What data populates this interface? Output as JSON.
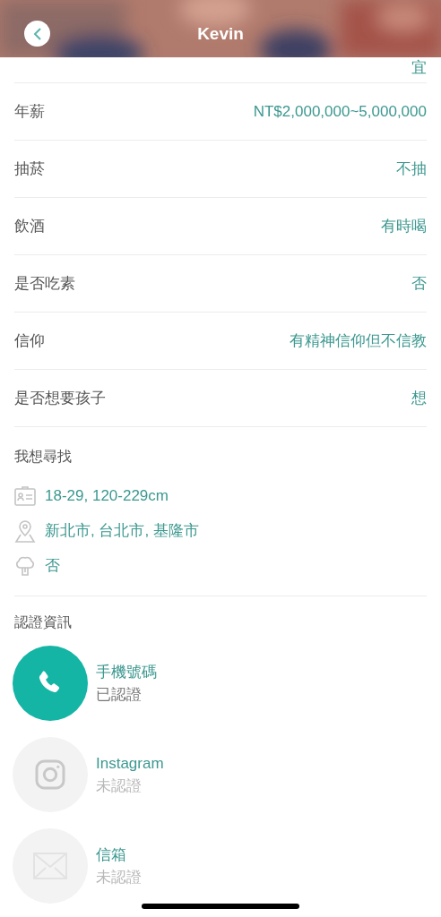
{
  "header": {
    "title": "Kevin"
  },
  "rows": [
    {
      "value": "宜"
    },
    {
      "label": "年薪",
      "value": "NT$2,000,000~5,000,000"
    },
    {
      "label": "抽菸",
      "value": "不抽"
    },
    {
      "label": "飲酒",
      "value": "有時喝"
    },
    {
      "label": "是否吃素",
      "value": "否"
    },
    {
      "label": "信仰",
      "value": "有精神信仰但不信教"
    },
    {
      "label": "是否想要孩子",
      "value": "想"
    }
  ],
  "looking_for": {
    "title": "我想尋找",
    "items": [
      {
        "kind": "profile",
        "text": "18-29, 120-229cm"
      },
      {
        "kind": "location",
        "text": "新北市, 台北市, 基隆市"
      },
      {
        "kind": "diet",
        "text": "否"
      }
    ]
  },
  "verification": {
    "title": "認證資訊",
    "items": [
      {
        "kind": "phone",
        "name": "手機號碼",
        "status": "已認證",
        "verified": true
      },
      {
        "kind": "instagram",
        "name": "Instagram",
        "status": "未認證",
        "verified": false
      },
      {
        "kind": "email",
        "name": "信箱",
        "status": "未認證",
        "verified": false
      }
    ]
  }
}
